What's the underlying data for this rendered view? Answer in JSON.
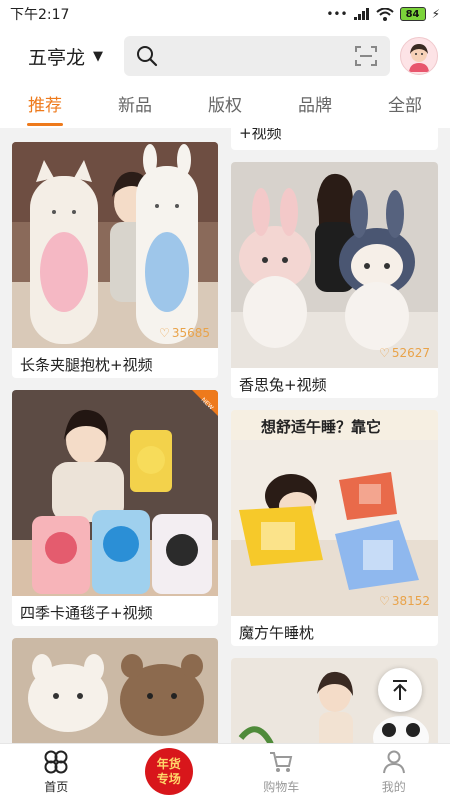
{
  "status_bar": {
    "time": "下午2:17",
    "battery": "84"
  },
  "header": {
    "location": "五亭龙"
  },
  "tabs": [
    {
      "label": "推荐",
      "active": true
    },
    {
      "label": "新品",
      "active": false
    },
    {
      "label": "版权",
      "active": false
    },
    {
      "label": "品牌",
      "active": false
    },
    {
      "label": "全部",
      "active": false
    }
  ],
  "feed": {
    "top_right_partial_caption": "+视频",
    "items": [
      {
        "caption": "长条夹腿抱枕+视频",
        "likes": "35685"
      },
      {
        "caption": "香思兔+视频",
        "likes": "52627"
      },
      {
        "caption": "四季卡通毯子+视频",
        "likes": "",
        "badge": "NEW"
      },
      {
        "caption": "魔方午睡枕",
        "likes": "38152",
        "banner_text": "想舒适午睡？靠它"
      }
    ]
  },
  "bottom_nav": {
    "items": [
      {
        "label": "首页",
        "active": true
      },
      {
        "label": "年货\n专场",
        "promo": true
      },
      {
        "label": "购物车",
        "active": false
      },
      {
        "label": "我的",
        "active": false
      }
    ],
    "promo_line1": "年货",
    "promo_line2": "专场"
  },
  "colors": {
    "accent": "#ee7a1c",
    "promo_red": "#d8161b",
    "likes": "#e9a34a"
  }
}
